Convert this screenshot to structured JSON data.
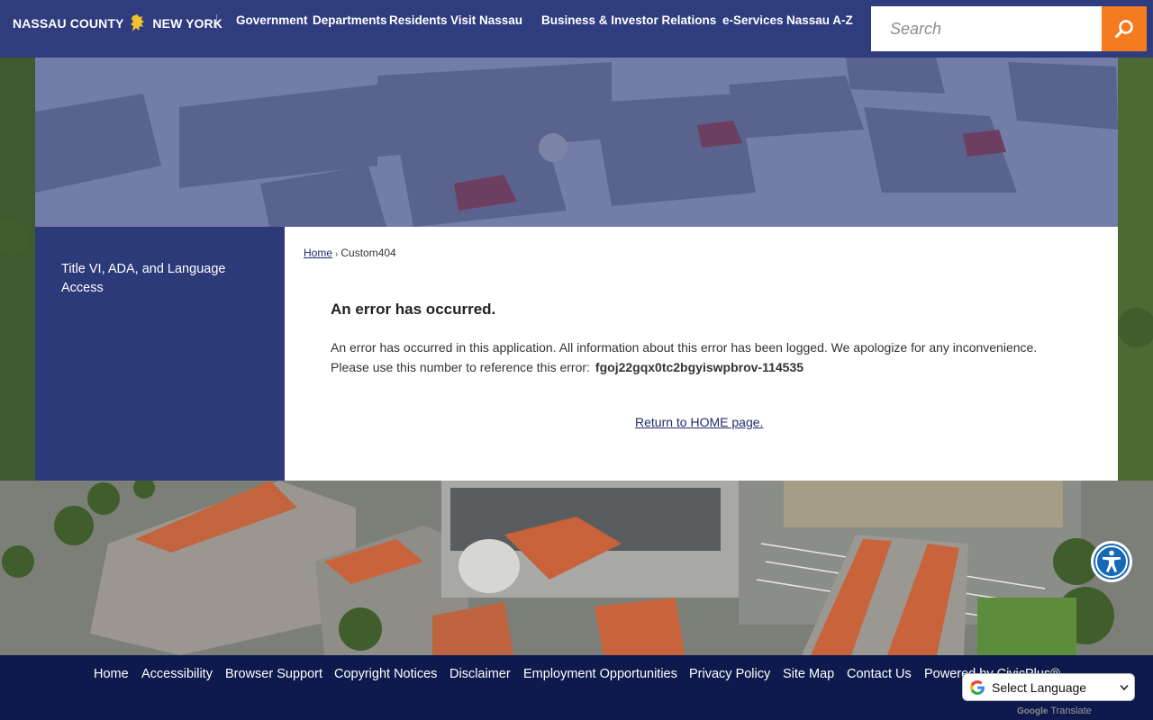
{
  "header": {
    "logo_left": "NASSAU COUNTY",
    "logo_right": "NEW YORK",
    "nav": [
      {
        "label": "Government"
      },
      {
        "label": "Departments"
      },
      {
        "label": "Residents"
      },
      {
        "label": "Visit Nassau"
      },
      {
        "label": "Business & Investor Relations"
      },
      {
        "label": "e-Services"
      },
      {
        "label": "Nassau A-Z"
      }
    ],
    "search_placeholder": "Search"
  },
  "sidebar": {
    "link": "Title VI, ADA, and Language Access"
  },
  "breadcrumb": {
    "home": "Home",
    "separator": "›",
    "current": "Custom404"
  },
  "error": {
    "title": "An error has occurred.",
    "line1": "An error has occurred in this application. All information about this error has been logged. We apologize for any inconvenience.",
    "line2": "Please use this number to reference this error:",
    "code": "fgoj22gqx0tc2bgyiswpbrov-114535",
    "return_link": "Return to HOME page."
  },
  "footer": {
    "links": [
      {
        "label": "Home"
      },
      {
        "label": "Accessibility"
      },
      {
        "label": "Browser Support"
      },
      {
        "label": "Copyright Notices"
      },
      {
        "label": "Disclaimer"
      },
      {
        "label": "Employment Opportunities"
      },
      {
        "label": "Privacy Policy"
      },
      {
        "label": "Site Map"
      },
      {
        "label": "Contact Us"
      },
      {
        "label": "Powered by CivicPlus®"
      }
    ],
    "translate_label": "Select Language",
    "translate_brand": "Google",
    "translate_word": "Translate"
  },
  "colors": {
    "header_bg": "#2f3c7e",
    "search_button": "#f47b20",
    "footer_bg": "#0e1a4d",
    "sidebar_bg": "#2c3a79"
  }
}
